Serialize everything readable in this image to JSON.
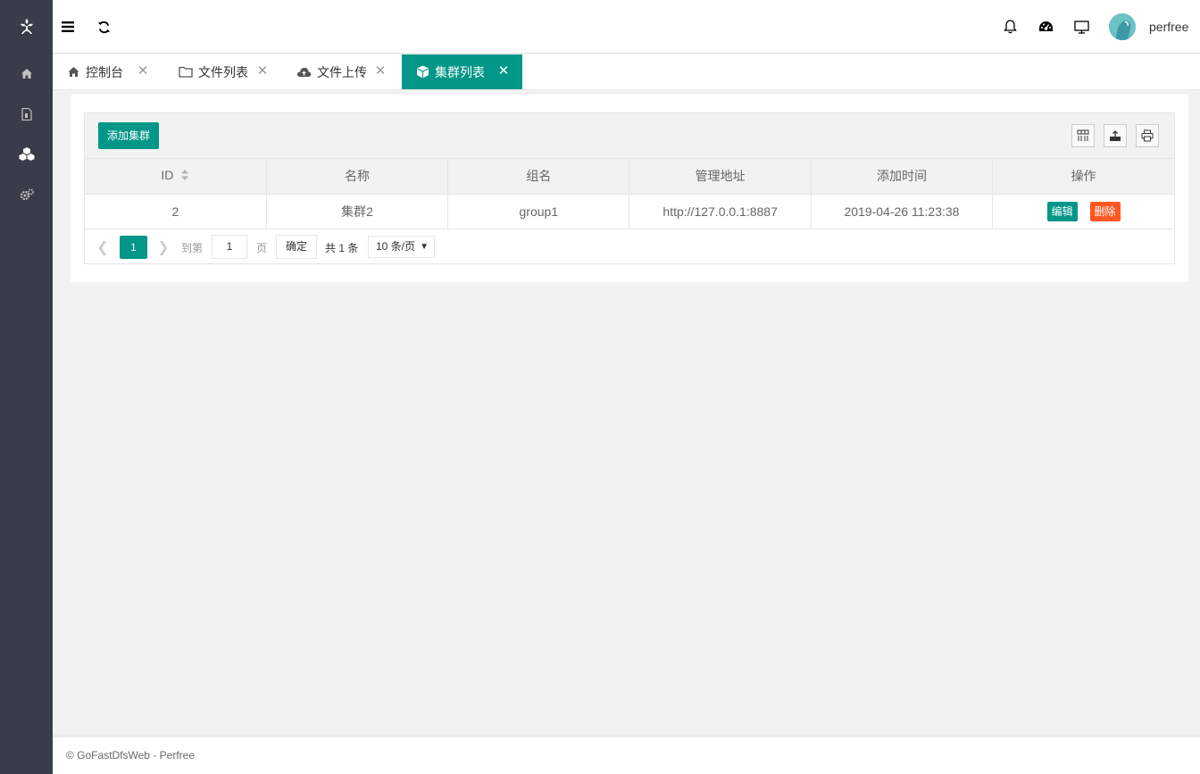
{
  "header": {
    "username": "perfree"
  },
  "tabs": [
    {
      "label": "控制台"
    },
    {
      "label": "文件列表"
    },
    {
      "label": "文件上传"
    },
    {
      "label": "集群列表"
    }
  ],
  "toolbar": {
    "add_label": "添加集群"
  },
  "table": {
    "columns": [
      "ID",
      "名称",
      "组名",
      "管理地址",
      "添加时间",
      "操作"
    ],
    "rows": [
      {
        "id": "2",
        "name": "集群2",
        "group": "group1",
        "url": "http://127.0.0.1:8887",
        "time": "2019-04-26 11:23:38",
        "edit": "编辑",
        "delete": "删除"
      }
    ]
  },
  "pager": {
    "current": "1",
    "goto_label": "到第",
    "page_input": "1",
    "page_suffix": "页",
    "confirm": "确定",
    "total": "共 1 条",
    "page_size": "10 条/页"
  },
  "footer": {
    "text": "© GoFastDfsWeb - Perfree"
  },
  "colors": {
    "accent": "#009688",
    "danger": "#ff5722",
    "sidebar": "#393d49"
  }
}
